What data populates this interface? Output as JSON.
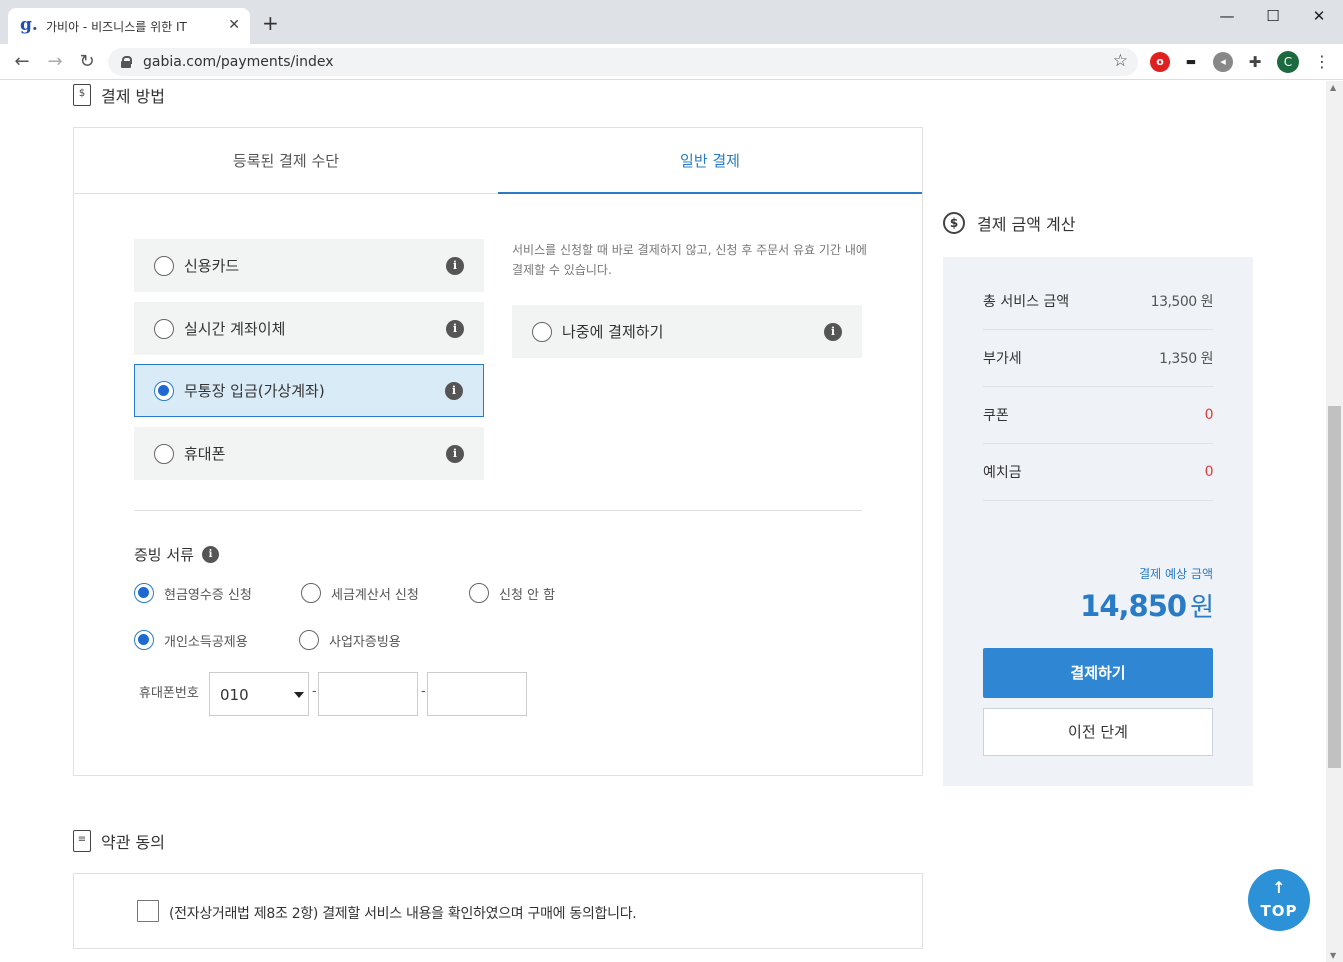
{
  "browser": {
    "tab_title": "가비아 - 비즈니스를 위한 IT",
    "favicon": "g.",
    "url": "gabia.com/payments/index",
    "profile_initial": "C"
  },
  "payment_method": {
    "title": "결제 방법",
    "tabs": [
      {
        "label": "등록된 결제 수단",
        "active": false
      },
      {
        "label": "일반 결제",
        "active": true
      }
    ],
    "methods": [
      {
        "label": "신용카드",
        "selected": false
      },
      {
        "label": "실시간 계좌이체",
        "selected": false
      },
      {
        "label": "무통장 입금(가상계좌)",
        "selected": true
      },
      {
        "label": "휴대폰",
        "selected": false
      }
    ],
    "later_description": "서비스를 신청할 때 바로 결제하지 않고, 신청 후 주문서 유효 기간 내에 결제할 수 있습니다.",
    "later_label": "나중에 결제하기"
  },
  "evidence": {
    "title": "증빙 서류",
    "options": [
      {
        "label": "현금영수증 신청",
        "selected": true
      },
      {
        "label": "세금계산서 신청",
        "selected": false
      },
      {
        "label": "신청 안 함",
        "selected": false
      }
    ],
    "sub_options": [
      {
        "label": "개인소득공제용",
        "selected": true
      },
      {
        "label": "사업자증빙용",
        "selected": false
      }
    ],
    "phone_label": "휴대폰번호",
    "phone_prefix": "010",
    "dash": "-"
  },
  "summary": {
    "title": "결제 금액 계산",
    "rows": [
      {
        "label": "총 서비스 금액",
        "value": "13,500 원"
      },
      {
        "label": "부가세",
        "value": "1,350 원"
      },
      {
        "label": "쿠폰",
        "value": "0"
      },
      {
        "label": "예치금",
        "value": "0"
      }
    ],
    "estimate_label": "결제 예상 금액",
    "estimate_value": "14,850",
    "estimate_unit": "원",
    "pay_button": "결제하기",
    "prev_button": "이전 단계"
  },
  "terms": {
    "title": "약관 동의",
    "agree_text": "(전자상거래법 제8조 2항) 결제할 서비스 내용을 확인하였으며 구매에 동의합니다."
  },
  "top_button": "TOP",
  "colors": {
    "accent": "#2a7bc6",
    "button": "#2f86d2",
    "negative": "#e03c3c",
    "summary_bg": "#eff2f6"
  }
}
